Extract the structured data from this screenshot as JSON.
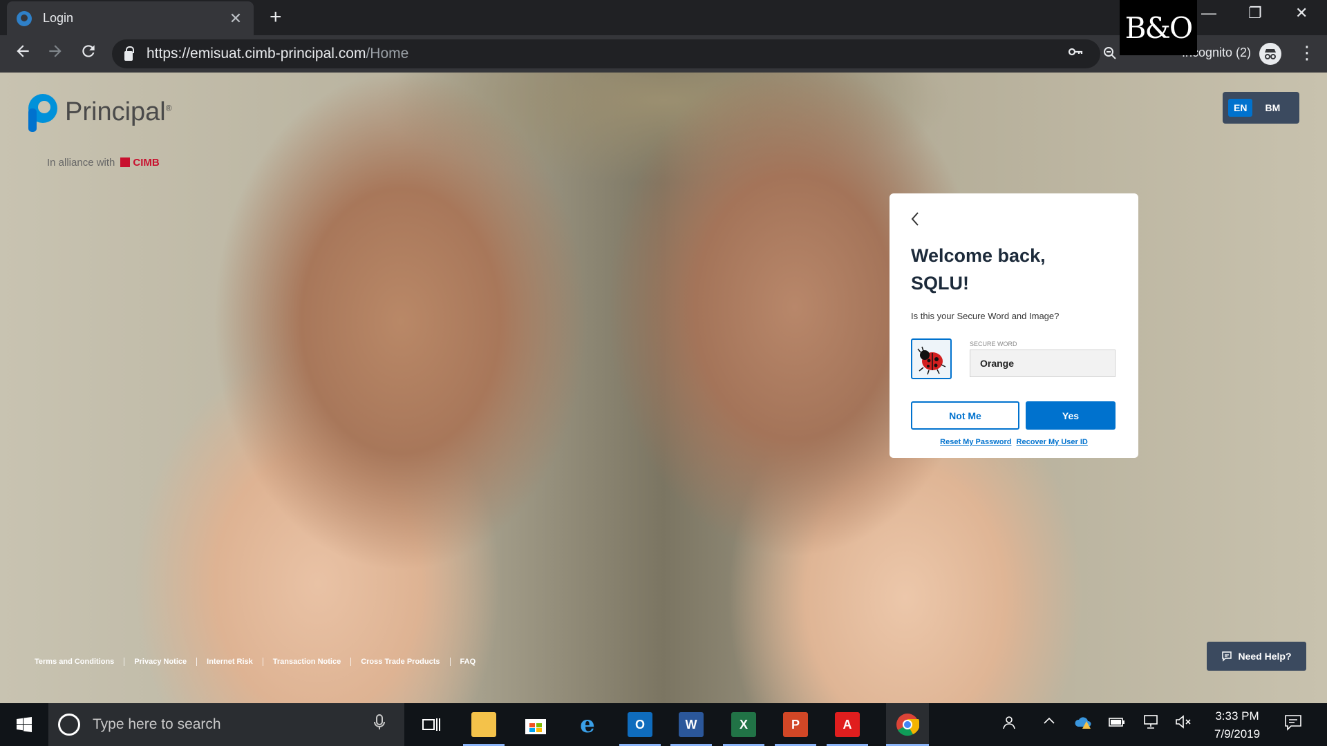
{
  "browser": {
    "tab_title": "Login",
    "tab_close": "✕",
    "new_tab": "+",
    "url_host": "https://emisuat.cimb-principal.com",
    "url_path": "/Home",
    "incognito_label": "Incognito (2)",
    "window_controls": [
      "—",
      "❐",
      "✕"
    ],
    "overlay_logo": "B&O"
  },
  "site": {
    "logo_name": "Principal",
    "logo_registered": "®",
    "alliance_text": "In alliance with",
    "alliance_partner": "CIMB",
    "languages": [
      "EN",
      "BM"
    ],
    "active_language": "EN"
  },
  "login_card": {
    "back_icon": "chevron-left",
    "welcome_line1": "Welcome back,",
    "welcome_line2": "SQLU!",
    "question": "Is this your Secure Word and Image?",
    "secure_word_label": "SECURE WORD",
    "secure_word_value": "Orange",
    "secure_image": "ladybug",
    "not_me_label": "Not Me",
    "yes_label": "Yes",
    "reset_password_label": "Reset My Password",
    "recover_user_id_label": "Recover My User ID"
  },
  "footer": {
    "links": [
      "Terms and Conditions",
      "Privacy Notice",
      "Internet Risk",
      "Transaction Notice",
      "Cross Trade Products",
      "FAQ"
    ]
  },
  "need_help_label": "Need Help?",
  "taskbar": {
    "search_placeholder": "Type here to search",
    "time": "3:33 PM",
    "date": "7/9/2019",
    "apps": [
      "task-view",
      "file-explorer",
      "store",
      "internet-explorer",
      "outlook",
      "word",
      "excel",
      "powerpoint",
      "acrobat",
      "chrome"
    ]
  },
  "colors": {
    "accent": "#0072ce",
    "panel": "#3b4a5f",
    "cimb_red": "#c8102e"
  }
}
